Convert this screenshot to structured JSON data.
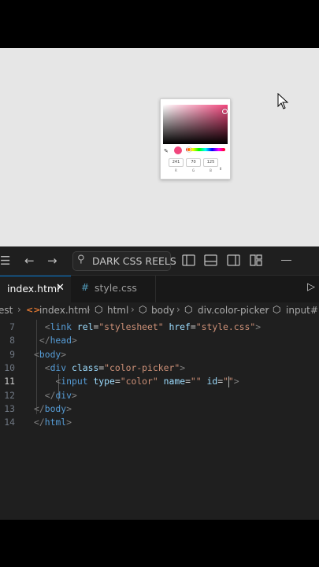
{
  "preview": {
    "picker": {
      "current_color": "#f1467d",
      "channels": [
        {
          "value": "241",
          "label": "R"
        },
        {
          "value": "70",
          "label": "G"
        },
        {
          "value": "125",
          "label": "B"
        }
      ]
    }
  },
  "editor": {
    "titlebar": {
      "search_label": "DARK CSS REELS"
    },
    "tabs": [
      {
        "label": "index.html",
        "active": true
      },
      {
        "label": "style.css",
        "active": false
      }
    ],
    "breadcrumb": [
      "est",
      "index.html",
      "html",
      "body",
      "div.color-picker",
      "input#"
    ],
    "lines": [
      {
        "num": "7",
        "parts": [
          [
            "punct",
            "<"
          ],
          [
            "tag",
            "link"
          ],
          [
            "eq",
            " "
          ],
          [
            "attr",
            "rel"
          ],
          [
            "eq",
            "="
          ],
          [
            "str",
            "\"stylesheet\""
          ],
          [
            "eq",
            " "
          ],
          [
            "attr",
            "href"
          ],
          [
            "eq",
            "="
          ],
          [
            "str",
            "\"style.css\""
          ],
          [
            "punct",
            ">"
          ]
        ],
        "indent": 2
      },
      {
        "num": "8",
        "parts": [
          [
            "punct",
            "</"
          ],
          [
            "tag",
            "head"
          ],
          [
            "punct",
            ">"
          ]
        ],
        "indent": 1
      },
      {
        "num": "9",
        "parts": [
          [
            "punct",
            "<"
          ],
          [
            "tag",
            "body"
          ],
          [
            "punct",
            ">"
          ]
        ],
        "indent": 0
      },
      {
        "num": "10",
        "parts": [
          [
            "punct",
            "<"
          ],
          [
            "tag",
            "div"
          ],
          [
            "eq",
            " "
          ],
          [
            "attr",
            "class"
          ],
          [
            "eq",
            "="
          ],
          [
            "str",
            "\"color-picker\""
          ],
          [
            "punct",
            ">"
          ]
        ],
        "indent": 2
      },
      {
        "num": "11",
        "parts": [
          [
            "punct",
            "<"
          ],
          [
            "tag",
            "input"
          ],
          [
            "eq",
            " "
          ],
          [
            "attr",
            "type"
          ],
          [
            "eq",
            "="
          ],
          [
            "str",
            "\"color\""
          ],
          [
            "eq",
            " "
          ],
          [
            "attr",
            "name"
          ],
          [
            "eq",
            "="
          ],
          [
            "str",
            "\"\""
          ],
          [
            "eq",
            " "
          ],
          [
            "attr",
            "id"
          ],
          [
            "eq",
            "="
          ],
          [
            "str",
            "\"\""
          ],
          [
            "punct",
            ">"
          ]
        ],
        "indent": 4,
        "active": true
      },
      {
        "num": "12",
        "parts": [
          [
            "punct",
            "</"
          ],
          [
            "tag",
            "div"
          ],
          [
            "punct",
            ">"
          ]
        ],
        "indent": 2
      },
      {
        "num": "13",
        "parts": [
          [
            "punct",
            "</"
          ],
          [
            "tag",
            "body"
          ],
          [
            "punct",
            ">"
          ]
        ],
        "indent": 0
      },
      {
        "num": "14",
        "parts": [
          [
            "punct",
            "</"
          ],
          [
            "tag",
            "html"
          ],
          [
            "punct",
            ">"
          ]
        ],
        "indent": 0
      }
    ]
  }
}
